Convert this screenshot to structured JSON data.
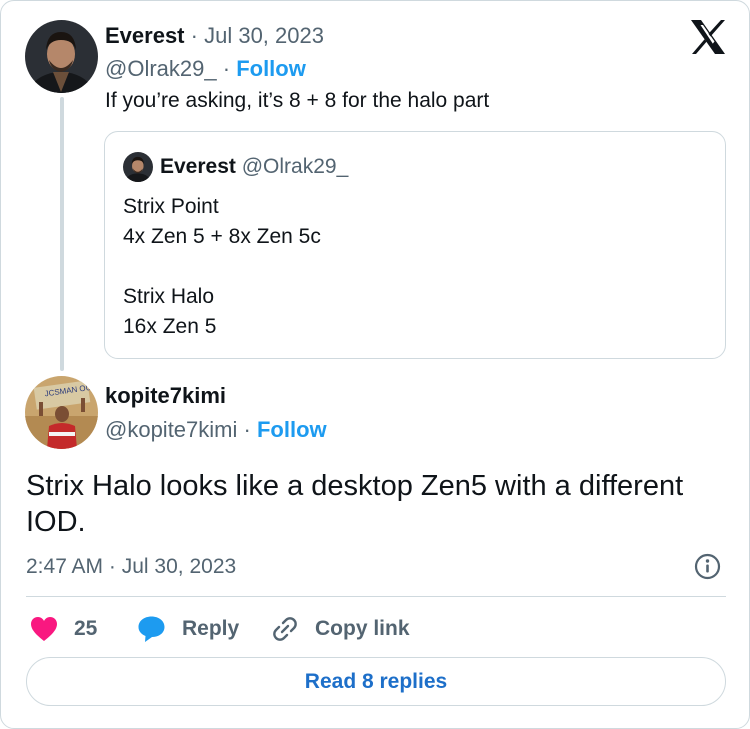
{
  "parent_tweet": {
    "author_name": "Everest",
    "date_separator": "·",
    "date": "Jul 30, 2023",
    "handle": "@Olrak29_",
    "follow_separator": "·",
    "follow_label": "Follow",
    "text": "If you’re asking, it’s 8 + 8 for the halo part"
  },
  "quoted_tweet": {
    "author_name": "Everest",
    "handle": "@Olrak29_",
    "lines": [
      "Strix Point",
      "4x Zen 5 + 8x Zen 5c",
      "",
      "Strix Halo",
      "16x Zen 5"
    ]
  },
  "main_tweet": {
    "author_name": "kopite7kimi",
    "handle": "@kopite7kimi",
    "follow_separator": "·",
    "follow_label": "Follow",
    "text": "Strix Halo looks like a desktop Zen5 with a different IOD.",
    "time": "2:47 AM",
    "date_separator": "·",
    "date": "Jul 30, 2023"
  },
  "actions": {
    "like_count": "25",
    "reply_label": "Reply",
    "copy_link_label": "Copy link"
  },
  "read_replies_label": "Read 8 replies",
  "avatar_sign_text": "JCSMAN OUT",
  "icons": {
    "logo": "x-logo-icon",
    "info": "info-icon",
    "like": "heart-icon",
    "reply": "speech-bubble-icon",
    "copy": "link-icon"
  },
  "colors": {
    "accent": "#1d9bf0",
    "like": "#f91880",
    "muted_text": "#536471",
    "border": "#cfd9de"
  }
}
